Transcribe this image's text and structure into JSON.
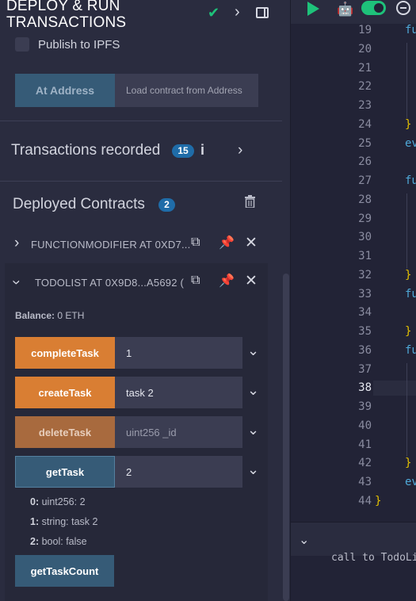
{
  "panel": {
    "title_line1": "DEPLOY & RUN",
    "title_line2": "TRANSACTIONS",
    "publish_label": "Publish to IPFS",
    "at_address_label": "At Address",
    "at_address_placeholder": "Load contract from Address"
  },
  "transactions": {
    "label": "Transactions recorded",
    "count": "15",
    "info": "i"
  },
  "deployed": {
    "label": "Deployed Contracts",
    "count": "2",
    "contracts": [
      {
        "name": "FUNCTIONMODIFIER AT 0XD7..."
      },
      {
        "name": "TODOLIST AT 0X9D8...A5692 ("
      }
    ]
  },
  "todolist": {
    "balance_label": "Balance:",
    "balance_value": "0 ETH",
    "functions": [
      {
        "label": "completeTask",
        "value": "1",
        "placeholder": ""
      },
      {
        "label": "createTask",
        "value": "task 2",
        "placeholder": ""
      },
      {
        "label": "deleteTask",
        "value": "",
        "placeholder": "uint256 _id"
      },
      {
        "label": "getTask",
        "value": "2",
        "placeholder": ""
      }
    ],
    "results": [
      {
        "key": "0:",
        "value": "uint256: 2"
      },
      {
        "key": "1:",
        "value": "string: task 2"
      },
      {
        "key": "2:",
        "value": "bool: false"
      }
    ],
    "count_button": "getTaskCount"
  },
  "editor": {
    "line_numbers": [
      "19",
      "20",
      "21",
      "22",
      "23",
      "24",
      "25",
      "26",
      "27",
      "28",
      "29",
      "30",
      "31",
      "32",
      "33",
      "34",
      "35",
      "36",
      "37",
      "38",
      "39",
      "40",
      "41",
      "42",
      "43",
      "44"
    ],
    "current_line": "38",
    "code_fragments": [
      {
        "line": "19",
        "text": "fu"
      },
      {
        "line": "24",
        "text": "}"
      },
      {
        "line": "25",
        "text": "ev"
      },
      {
        "line": "27",
        "text": "fu"
      },
      {
        "line": "32",
        "text": "}"
      },
      {
        "line": "33",
        "text": "fu"
      },
      {
        "line": "35",
        "text": "}"
      },
      {
        "line": "36",
        "text": "fu"
      },
      {
        "line": "42",
        "text": "}"
      },
      {
        "line": "43",
        "text": "ev"
      },
      {
        "line": "44",
        "text": "}"
      }
    ],
    "terminal_text": "call to TodoLis"
  },
  "colors": {
    "accent_green": "#1ec27a",
    "button_orange": "#d97e33",
    "button_blue": "#365b77",
    "badge_blue": "#1f6ca8"
  }
}
